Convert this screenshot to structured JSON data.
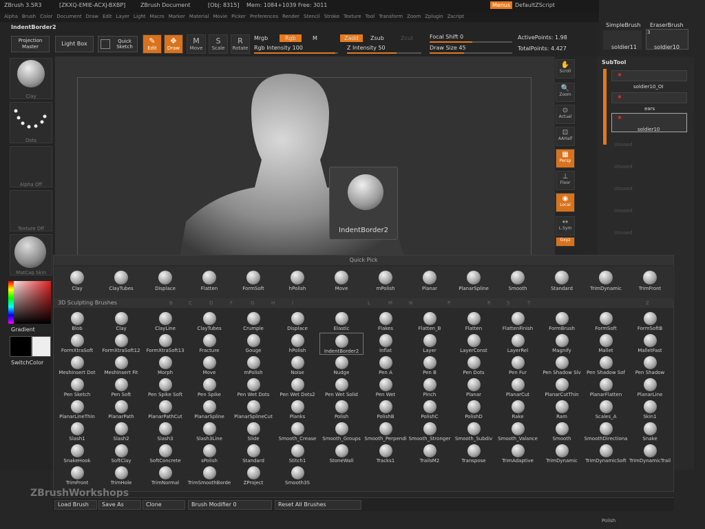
{
  "title": {
    "app": "ZBrush 3.5R3",
    "serial": "[ZKXQ-EMIE-ACXJ-BXBP]",
    "document": "ZBrush Document",
    "obj": "[Obj: 8315]",
    "mem": "Mem: 1084+1039 Free: 3011",
    "menus_btn": "Menus",
    "script": "DefaultZScript"
  },
  "menu_items": [
    "Alpha",
    "Brush",
    "Color",
    "Document",
    "Draw",
    "Edit",
    "Layer",
    "Light",
    "Macro",
    "Marker",
    "Material",
    "Movie",
    "Picker",
    "Preferences",
    "Render",
    "Stencil",
    "Stroke",
    "Texture",
    "Tool",
    "Transform",
    "Zoom",
    "Zplugin",
    "Zscript"
  ],
  "toolbar": {
    "current_brush": "IndentBorder2",
    "projection_master": "Projection Master",
    "light_box": "Light Box",
    "quick_sketch": "Quick Sketch",
    "edit": "Edit",
    "draw": "Draw",
    "move": "Move",
    "scale": "Scale",
    "rotate": "Rotate",
    "mrgb": "Mrgb",
    "rgb": "Rgb",
    "m": "M",
    "rgb_intensity": "Rgb Intensity 100",
    "zadd": "Zadd",
    "zsub": "Zsub",
    "zcut": "Zcut",
    "z_intensity": "Z Intensity 50",
    "focal_shift": "Focal Shift 0",
    "draw_size": "Draw Size 45",
    "active_points": "ActivePoints: 1.98",
    "total_points": "TotalPoints: 4.427"
  },
  "left_shelf": {
    "brush_cap": "Clay",
    "stroke_cap": "Dots",
    "alpha_cap": "Alpha Off",
    "texture_cap": "Texture Off",
    "material_cap": "MatCap Skin",
    "gradient": "Gradient",
    "switch_color": "SwitchColor"
  },
  "viewport": {
    "tooltip": "IndentBorder2",
    "watermark": "ZBrushWorkshops"
  },
  "right_shelf": [
    "Scroll",
    "Zoom",
    "Actual",
    "AAHalf",
    "Persp",
    "Floor",
    "Local",
    "L.Sym",
    "Gxyz"
  ],
  "tool_panel": {
    "tool1": "SimpleBrush",
    "tool2": "EraserBrush",
    "tool3": "soldier11",
    "tool4": "soldier10",
    "tool4_count": "3",
    "subtool_title": "SubTool",
    "sub1": "soldier10_OI",
    "sub2": "ears",
    "sub3": "soldier10",
    "empty": [
      "Unused",
      "Unused",
      "Unused",
      "Unused",
      "Unused"
    ],
    "polish": "Polish"
  },
  "quick_pick": {
    "title": "Quick Pick",
    "brushes": [
      "Clay",
      "ClayTubes",
      "Displace",
      "Flatten",
      "FormSoft",
      "hPolish",
      "Move",
      "mPolish",
      "Planar",
      "PlanarSpline",
      "Smooth",
      "Standard",
      "TrimDynamic",
      "TrimFront"
    ]
  },
  "sculpt": {
    "title": "3D Sculpting Brushes",
    "letters": [
      "B",
      "C",
      "D",
      "F",
      "G",
      "H",
      "I",
      "L",
      "M",
      "N",
      "P",
      "R",
      "S",
      "T",
      "Z"
    ],
    "brushes": [
      "Blob",
      "Clay",
      "ClayLine",
      "ClayTubes",
      "Crumple",
      "Displace",
      "Elastic",
      "Flakes",
      "Flatten_B",
      "Flatten",
      "FlattenFinish",
      "FormBrush",
      "FormSoft",
      "FormSoftB",
      "FormXtraSoft",
      "FormXtraSoft12",
      "FormXtraSoft13",
      "Fracture",
      "Gouge",
      "hPolish",
      "IndentBorder2",
      "Inflat",
      "Layer",
      "LayerConst",
      "LayerRel",
      "Magnify",
      "Mallet",
      "MalletFast",
      "MeshInsert Dot",
      "MeshInsert Fit",
      "Morph",
      "Move",
      "mPolish",
      "Noise",
      "Nudge",
      "Pen A",
      "Pen B",
      "Pen Dots",
      "Pen Fur",
      "Pen Shadow Slv",
      "Pen Shadow Sof",
      "Pen Shadow",
      "Pen Sketch",
      "Pen Soft",
      "Pen Spike Soft",
      "Pen Spike",
      "Pen Wet Dots",
      "Pen Wet Dots2",
      "Pen Wet Solid",
      "Pen Wet",
      "Pinch",
      "Planar",
      "PlanarCut",
      "PlanarCutThin",
      "PlanarFlatten",
      "PlanarLine",
      "PlanarLineThin",
      "PlanarPath",
      "PlanarPathCut",
      "PlanarSpline",
      "PlanarSplineCut",
      "Planks",
      "Polish",
      "PolishB",
      "PolishC",
      "PolishD",
      "Rake",
      "Ram",
      "Scales_A",
      "Skin1",
      "Slash1",
      "Slash2",
      "Slash3",
      "Slash3Line",
      "Slide",
      "Smooth_Crease",
      "Smooth_Groups",
      "Smooth_Perpendi",
      "Smooth_Stronger",
      "Smooth_Subdiv",
      "Smooth_Valance",
      "Smooth",
      "SmoothDirectiona",
      "Snake",
      "SnakeHook",
      "SoftClay",
      "SoftConcrete",
      "sPolish",
      "Standard",
      "Stitch1",
      "StoneWall",
      "Tracks1",
      "TrailsM2",
      "Transpose",
      "TrimAdaptive",
      "TrimDynamic",
      "TrimDynamicSoft",
      "TrimDynamicTrail",
      "TrimFront",
      "TrimHole",
      "TrimNormal",
      "TrimSmoothBorde",
      "ZProject",
      "Smooth3S"
    ]
  },
  "bottom": {
    "load": "Load Brush",
    "save": "Save As",
    "clone": "Clone",
    "modifier": "Brush Modifier 0",
    "reset": "Reset All Brushes"
  },
  "colors": {
    "accent": "#e57a1e",
    "panel": "#2a2a2a",
    "bg": "#262626"
  }
}
